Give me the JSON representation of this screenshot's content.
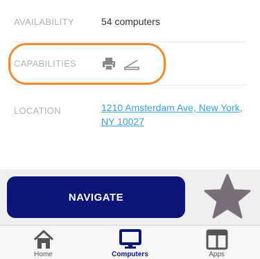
{
  "details": {
    "availability": {
      "label": "AVAILABILITY",
      "value": "54 computers"
    },
    "capabilities": {
      "label": "CAPABILITIES",
      "icons": [
        "printer-icon",
        "scanner-icon"
      ]
    },
    "location": {
      "label": "LOCATION",
      "value": "1210 Amsterdam Ave, New York, NY 10027"
    }
  },
  "actions": {
    "navigate_label": "NAVIGATE",
    "favorite_icon": "star-icon"
  },
  "tabs": [
    {
      "label": "Home",
      "icon": "home-icon",
      "active": false
    },
    {
      "label": "Computers",
      "icon": "computer-icon",
      "active": true
    },
    {
      "label": "Apps",
      "icon": "apps-icon",
      "active": false
    }
  ],
  "colors": {
    "primary": "#0b1677",
    "link": "#3aa0d9",
    "highlight": "#f2882f",
    "star": "#7a6e78",
    "label": "#b3b3b3"
  }
}
